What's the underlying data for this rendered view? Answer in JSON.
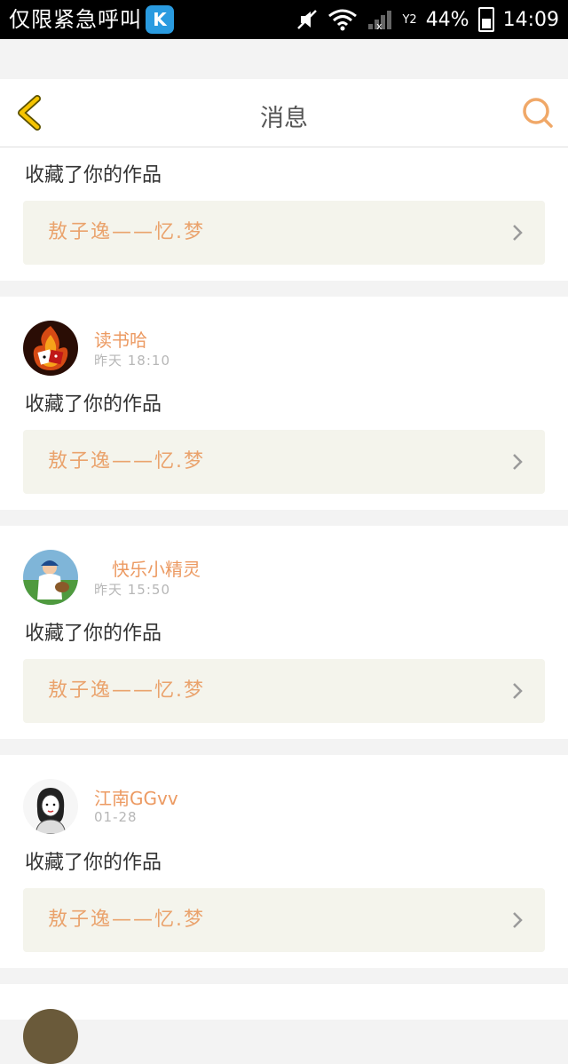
{
  "statusbar": {
    "carrier_text": "仅限紧急呼叫",
    "app_badge": "K",
    "signal_label": "Y2",
    "battery": "44%",
    "time": "14:09"
  },
  "navbar": {
    "title": "消息"
  },
  "messages": [
    {
      "action": "收藏了你的作品",
      "work_title": "敖子逸——忆.梦"
    },
    {
      "user": "读书哈",
      "time": "昨天  18:10",
      "action": "收藏了你的作品",
      "work_title": "敖子逸——忆.梦"
    },
    {
      "user": "快乐小精灵",
      "time": "昨天  15:50",
      "action": "收藏了你的作品",
      "work_title": "敖子逸——忆.梦"
    },
    {
      "user": "江南GGvv",
      "time": "01-28",
      "action": "收藏了你的作品",
      "work_title": "敖子逸——忆.梦"
    }
  ],
  "colors": {
    "accent_orange": "#ec9a62",
    "back_arrow": "#f5c400",
    "work_bg": "#f4f4ec"
  },
  "icons": {
    "back": "chevron-left-icon",
    "search": "search-icon",
    "chevron": "chevron-right-icon"
  }
}
